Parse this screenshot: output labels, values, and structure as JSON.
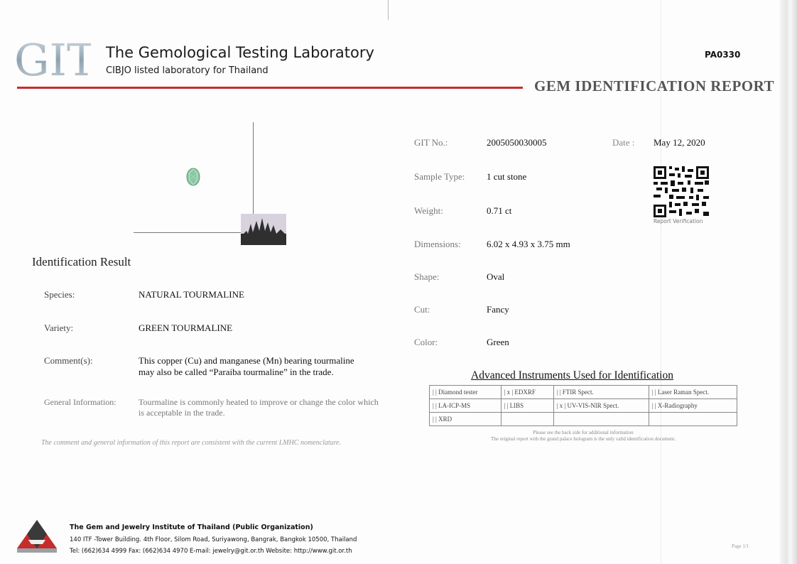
{
  "header": {
    "logo_text": "GIT",
    "lab_name": "The Gemological Testing Laboratory",
    "lab_subtitle": "CIBJO listed laboratory for Thailand",
    "report_number": "PA0330",
    "report_title": "GEM IDENTIFICATION REPORT",
    "accent_color": "#c62c2c"
  },
  "identification": {
    "title": "Identification Result",
    "species_label": "Species:",
    "species_value": "NATURAL TOURMALINE",
    "variety_label": "Variety:",
    "variety_value": "GREEN TOURMALINE",
    "comment_label": "Comment(s):",
    "comment_line1": "This copper (Cu) and manganese (Mn) bearing tourmaline",
    "comment_line2": "may also be called “Paraiba tourmaline” in the trade.",
    "general_label": "General Information:",
    "general_line1": "Tourmaline is commonly heated to improve or change the color which",
    "general_line2": "is acceptable in the trade.",
    "disclaimer": "The comment and general information of this report are consistent with the current LMHC nomenclature."
  },
  "details": {
    "git_no_label": "GIT No.:",
    "git_no_value": "2005050030005",
    "date_label": "Date :",
    "date_value": "May 12, 2020",
    "sample_type_label": "Sample Type:",
    "sample_type_value": "1 cut stone",
    "weight_label": "Weight:",
    "weight_value": "0.71 ct",
    "dimensions_label": "Dimensions:",
    "dimensions_value": "6.02 x 4.93 x 3.75 mm",
    "shape_label": "Shape:",
    "shape_value": "Oval",
    "cut_label": "Cut:",
    "cut_value": "Fancy",
    "color_label": "Color:",
    "color_value": "Green",
    "qr_caption": "Report Verification",
    "stone_color": "#8cc7a4"
  },
  "instruments": {
    "title": "Advanced Instruments Used for Identification",
    "rows": [
      [
        "|  | Diamond tester",
        "| x | EDXRF",
        "|  | FTIR Spect.",
        "|  | Laser Raman Spect."
      ],
      [
        "|  | LA-ICP-MS",
        "|  | LIBS",
        "| x | UV-VIS-NIR Spect.",
        "|  | X-Radiography"
      ],
      [
        "|  | XRD",
        "",
        "",
        ""
      ]
    ],
    "back_note": "Please see the back side for additional information",
    "original_note": "The original report with the grand palace hologram is the only valid identification document."
  },
  "footer": {
    "institute_name": "The Gem and Jewelry Institute of Thailand (Public Organization)",
    "address": "140 ITF -Tower Building. 4th Floor, Silom Road, Suriyawong, Bangrak, Bangkok 10500, Thailand",
    "contact": "Tel: (662)634 4999 Fax: (662)634 4970  E-mail: jewelry@git.or.th  Website: http://www.git.or.th",
    "page_number": "Page 1/1"
  }
}
